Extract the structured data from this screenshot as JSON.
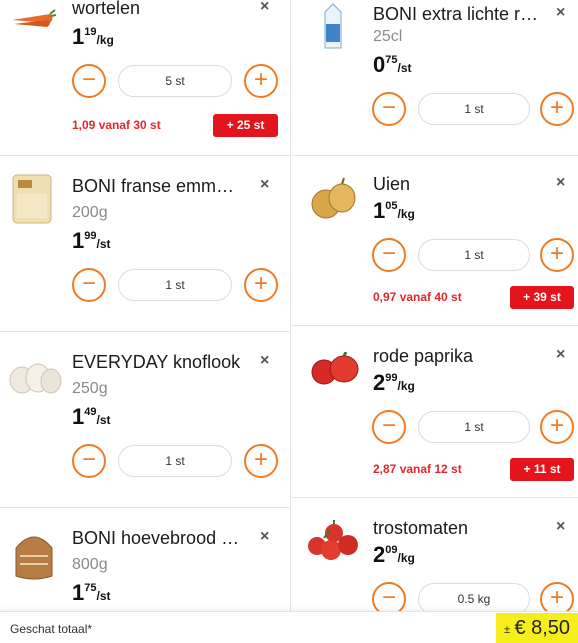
{
  "accent_color": "#f07b22",
  "promo_color": "#e3262d",
  "total_highlight_color": "#f6ee1a",
  "left_column": [
    {
      "name": "wortelen",
      "size": "",
      "price_main": "1",
      "price_cents": "19",
      "price_unit": "/kg",
      "quantity": "5 st",
      "promo_text": "1,09 vanaf 30 st",
      "promo_badge": "+ 25 st",
      "image_icon": "carrot-icon"
    },
    {
      "name": "BONI franse emm…",
      "size": "200g",
      "price_main": "1",
      "price_cents": "99",
      "price_unit": "/st",
      "quantity": "1 st",
      "promo_text": "",
      "promo_badge": "",
      "image_icon": "cheese-pack-icon"
    },
    {
      "name": "EVERYDAY knoflook",
      "size": "250g",
      "price_main": "1",
      "price_cents": "49",
      "price_unit": "/st",
      "quantity": "1 st",
      "promo_text": "",
      "promo_badge": "",
      "image_icon": "garlic-icon"
    },
    {
      "name": "BONI hoevebrood …",
      "size": "800g",
      "price_main": "1",
      "price_cents": "75",
      "price_unit": "/st",
      "quantity": "",
      "promo_text": "",
      "promo_badge": "",
      "image_icon": "bread-icon"
    }
  ],
  "right_column": [
    {
      "name": "BONI extra lichte r…",
      "size": "25cl",
      "price_main": "0",
      "price_cents": "75",
      "price_unit": "/st",
      "quantity": "1 st",
      "promo_text": "",
      "promo_badge": "",
      "image_icon": "cream-carton-icon"
    },
    {
      "name": "Uien",
      "size": "",
      "price_main": "1",
      "price_cents": "05",
      "price_unit": "/kg",
      "quantity": "1 st",
      "promo_text": "0,97 vanaf 40 st",
      "promo_badge": "+ 39 st",
      "image_icon": "onion-icon"
    },
    {
      "name": "rode paprika",
      "size": "",
      "price_main": "2",
      "price_cents": "99",
      "price_unit": "/kg",
      "quantity": "1 st",
      "promo_text": "2,87 vanaf 12 st",
      "promo_badge": "+ 11 st",
      "image_icon": "pepper-icon"
    },
    {
      "name": "trostomaten",
      "size": "",
      "price_main": "2",
      "price_cents": "09",
      "price_unit": "/kg",
      "quantity": "0.5 kg",
      "promo_text": "",
      "promo_badge": "",
      "image_icon": "tomato-icon"
    }
  ],
  "footer": {
    "label": "Geschat totaal*",
    "prefix": "±",
    "total": "€ 8,50"
  },
  "icons": {
    "minus": "−",
    "plus": "+",
    "close": "×"
  }
}
